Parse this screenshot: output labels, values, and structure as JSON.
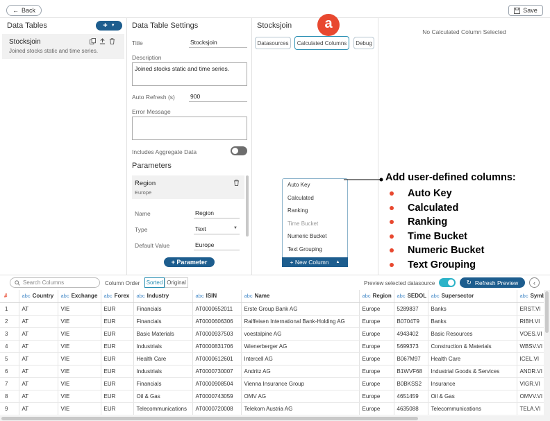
{
  "topbar": {
    "back_label": "Back",
    "save_label": "Save"
  },
  "left_panel": {
    "title": "Data Tables",
    "add_label": "+",
    "item": {
      "name": "Stocksjoin",
      "description": "Joined stocks static and time series."
    }
  },
  "settings": {
    "title": "Data Table Settings",
    "title_label": "Title",
    "title_value": "Stocksjoin",
    "description_label": "Description",
    "description_value": "Joined stocks static and time series.",
    "refresh_label": "Auto Refresh (s)",
    "refresh_value": "900",
    "error_label": "Error Message",
    "error_value": "",
    "aggregate_label": "Includes Aggregate Data",
    "parameters_title": "Parameters",
    "param": {
      "name": "Region",
      "value_preview": "Europe",
      "name_label": "Name",
      "name_value": "Region",
      "type_label": "Type",
      "type_value": "Text",
      "default_label": "Default Value",
      "default_value": "Europe"
    },
    "add_param_label": "+ Parameter"
  },
  "stocksjoin": {
    "title": "Stocksjoin",
    "tabs": [
      "Datasources",
      "Calculated Columns",
      "Debug"
    ],
    "badge": "a",
    "menu": [
      "Auto Key",
      "Calculated",
      "Ranking",
      "Time Bucket",
      "Numeric Bucket",
      "Text Grouping"
    ],
    "new_column_label": "+ New Column",
    "caret": "▲"
  },
  "right_panel": {
    "empty_text": "No Calculated Column Selected"
  },
  "callout": {
    "title": "Add user-defined columns:",
    "items": [
      "Auto Key",
      "Calculated",
      "Ranking",
      "Time Bucket",
      "Numeric Bucket",
      "Text Grouping"
    ]
  },
  "preview": {
    "search_placeholder": "Search Columns",
    "column_order_label": "Column Order",
    "sorted_label": "Sorted",
    "original_label": "Original",
    "preview_toggle_label": "Preview selected datasource",
    "refresh_label": "Refresh Preview",
    "hash": "#",
    "type_tag": "abc",
    "columns": [
      "Country",
      "Exchange",
      "Forex",
      "Industry",
      "ISIN",
      "Name",
      "Region",
      "SEDOL",
      "Supersector",
      "Symbol"
    ],
    "rows": [
      [
        "1",
        "AT",
        "VIE",
        "EUR",
        "Financials",
        "AT0000652011",
        "Erste Group Bank AG",
        "Europe",
        "5289837",
        "Banks",
        "ERST.VI"
      ],
      [
        "2",
        "AT",
        "VIE",
        "EUR",
        "Financials",
        "AT0000606306",
        "Raiffeisen International Bank-Holding AG",
        "Europe",
        "B0704T9",
        "Banks",
        "RIBH.VI"
      ],
      [
        "3",
        "AT",
        "VIE",
        "EUR",
        "Basic Materials",
        "AT0000937503",
        "voestalpine AG",
        "Europe",
        "4943402",
        "Basic Resources",
        "VOES.VI"
      ],
      [
        "4",
        "AT",
        "VIE",
        "EUR",
        "Industrials",
        "AT0000831706",
        "Wienerberger AG",
        "Europe",
        "5699373",
        "Construction & Materials",
        "WBSV.VI"
      ],
      [
        "5",
        "AT",
        "VIE",
        "EUR",
        "Health Care",
        "AT0000612601",
        "Intercell AG",
        "Europe",
        "B067M97",
        "Health Care",
        "ICEL.VI"
      ],
      [
        "6",
        "AT",
        "VIE",
        "EUR",
        "Industrials",
        "AT0000730007",
        "Andritz AG",
        "Europe",
        "B1WVF68",
        "Industrial Goods & Services",
        "ANDR.VI"
      ],
      [
        "7",
        "AT",
        "VIE",
        "EUR",
        "Financials",
        "AT0000908504",
        "Vienna Insurance Group",
        "Europe",
        "B0BKSS2",
        "Insurance",
        "VIGR.VI"
      ],
      [
        "8",
        "AT",
        "VIE",
        "EUR",
        "Oil & Gas",
        "AT0000743059",
        "OMV AG",
        "Europe",
        "4651459",
        "Oil & Gas",
        "OMVV.VI"
      ],
      [
        "9",
        "AT",
        "VIE",
        "EUR",
        "Telecommunications",
        "AT0000720008",
        "Telekom Austria AG",
        "Europe",
        "4635088",
        "Telecommunications",
        "TELA.VI"
      ]
    ]
  },
  "colors": {
    "accent": "#1d5d8e",
    "badge": "#e8482f",
    "toggle": "#2cb3c8"
  }
}
